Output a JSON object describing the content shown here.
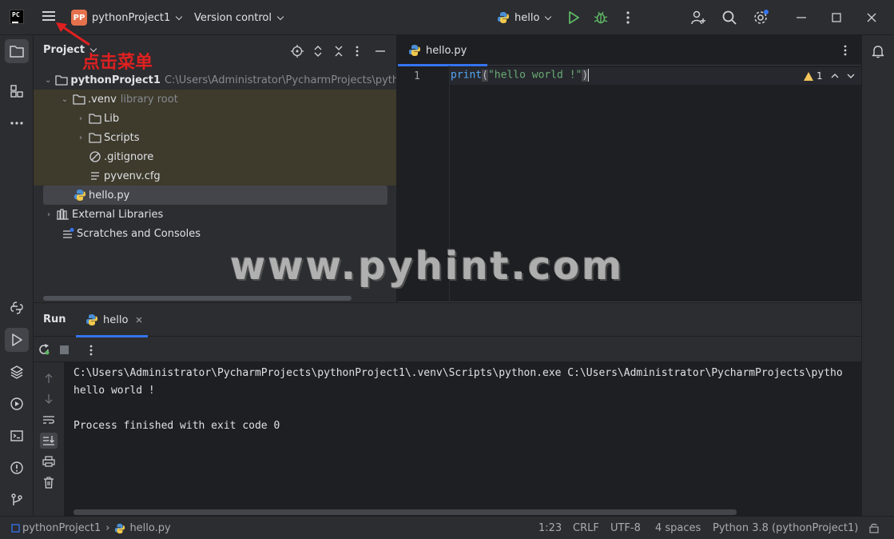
{
  "titlebar": {
    "logo_text": "PC",
    "project_badge": "PP",
    "project_name": "pythonProject1",
    "vcs_label": "Version control",
    "run_config": "hello"
  },
  "annotation": {
    "text": "点击菜单",
    "color": "#e02020"
  },
  "project_panel": {
    "title": "Project",
    "tree": [
      {
        "label": "pythonProject1",
        "hint": "C:\\Users\\Administrator\\PycharmProjects\\python"
      },
      {
        "label": ".venv",
        "hint": "library root"
      },
      {
        "label": "Lib"
      },
      {
        "label": "Scripts"
      },
      {
        "label": ".gitignore"
      },
      {
        "label": "pyvenv.cfg"
      },
      {
        "label": "hello.py"
      },
      {
        "label": "External Libraries"
      },
      {
        "label": "Scratches and Consoles"
      }
    ]
  },
  "editor": {
    "tab_label": "hello.py",
    "line_number": "1",
    "code": {
      "fn": "print",
      "open": "(",
      "str": "\"hello world !\"",
      "close": ")"
    },
    "warning_count": "1"
  },
  "watermark": "www.pyhint.com",
  "run_panel": {
    "title": "Run",
    "tab_label": "hello",
    "console": [
      "C:\\Users\\Administrator\\PycharmProjects\\pythonProject1\\.venv\\Scripts\\python.exe C:\\Users\\Administrator\\PycharmProjects\\pytho",
      "hello world !",
      "",
      "Process finished with exit code 0"
    ]
  },
  "statusbar": {
    "breadcrumb_project": "pythonProject1",
    "breadcrumb_file": "hello.py",
    "position": "1:23",
    "line_separator": "CRLF",
    "encoding": "UTF-8",
    "indent": "4 spaces",
    "interpreter": "Python 3.8 (pythonProject1)"
  },
  "colors": {
    "accent": "#3574f0",
    "run_green": "#5fb865",
    "warning": "#f2c55c",
    "project_badge": "#e5724d"
  }
}
